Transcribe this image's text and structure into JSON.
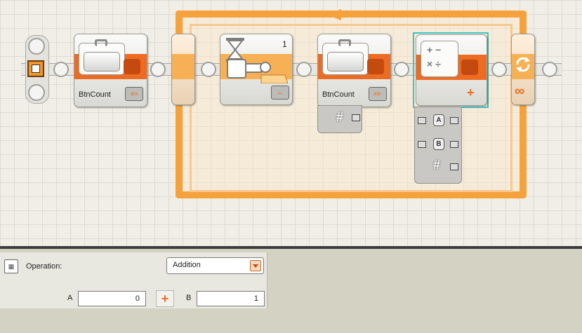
{
  "program": {
    "blocks": [
      {
        "type": "variable",
        "label": "BtnCount",
        "mode": "write"
      },
      {
        "type": "wait",
        "label": "",
        "port": "1"
      },
      {
        "type": "variable",
        "label": "BtnCount",
        "mode": "read"
      },
      {
        "type": "math",
        "label": "",
        "operation": "addition"
      }
    ],
    "math_plugs": [
      "A",
      "B",
      "#"
    ],
    "read_plug": "#",
    "loop_mode": "∞"
  },
  "panel": {
    "operation_label": "Operation:",
    "operation_value": "Addition",
    "a_label": "A",
    "a_value": "0",
    "b_label": "B",
    "b_value": "1"
  },
  "colors": {
    "block_orange": "#ee6b22",
    "loop_orange": "#f6a23c",
    "selection": "#3ec4c4"
  }
}
